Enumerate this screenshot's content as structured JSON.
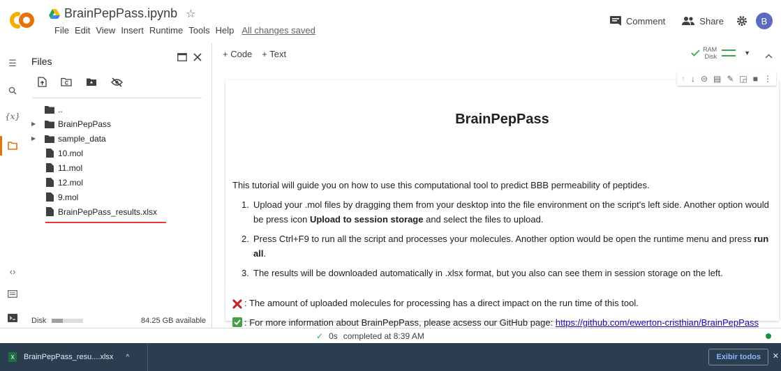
{
  "header": {
    "notebook_title": "BrainPepPass.ipynb",
    "menu": [
      "File",
      "Edit",
      "View",
      "Insert",
      "Runtime",
      "Tools",
      "Help"
    ],
    "save_status": "All changes saved",
    "comment_label": "Comment",
    "share_label": "Share",
    "avatar_letter": "B"
  },
  "files_panel": {
    "title": "Files",
    "tree": [
      {
        "label": "..",
        "type": "folder",
        "expandable": false
      },
      {
        "label": "BrainPepPass",
        "type": "folder",
        "expandable": true
      },
      {
        "label": "sample_data",
        "type": "folder",
        "expandable": true
      },
      {
        "label": "10.mol",
        "type": "file",
        "expandable": false
      },
      {
        "label": "11.mol",
        "type": "file",
        "expandable": false
      },
      {
        "label": "12.mol",
        "type": "file",
        "expandable": false
      },
      {
        "label": "9.mol",
        "type": "file",
        "expandable": false
      },
      {
        "label": "BrainPepPass_results.xlsx",
        "type": "file",
        "expandable": false
      }
    ],
    "disk_label": "Disk",
    "disk_fill_fraction": 0.35,
    "disk_available": "84.25 GB available"
  },
  "toolbar": {
    "add_code": "+ Code",
    "add_text": "+ Text",
    "ram_label": "RAM",
    "disk_label": "Disk"
  },
  "cell": {
    "heading": "BrainPepPass",
    "intro": "This tutorial will guide you on how to use this computational tool to predict BBB permeability of peptides.",
    "steps": [
      {
        "num": "1.",
        "before": "Upload your .mol files by dragging them from your desktop into the file environment on the script's left side. Another option would be press icon ",
        "bold": "Upload to session storage",
        "after": " and select the files to upload."
      },
      {
        "num": "2.",
        "before": "Press Ctrl+F9 to run all the script and processes your molecules. Another option would be open the runtime menu and press ",
        "bold": "run all",
        "after": "."
      },
      {
        "num": "3.",
        "before": "The results will be downloaded automatically in .xlsx format, but you also can see them in session storage on the left.",
        "bold": "",
        "after": ""
      }
    ],
    "warning_note": ": The amount of uploaded molecules for processing has a direct impact on the run time of this tool.",
    "info_note_before": ": For more information about BrainPepPass, please acsess our GitHub page: ",
    "info_link": "https://github.com/ewerton-cristhian/BrainPepPass"
  },
  "status_bar": {
    "check": "✓",
    "duration": "0s",
    "completed": "completed at 8:39 AM"
  },
  "download_bar": {
    "file_name": "BrainPepPass_resu....xlsx",
    "show_all": "Exibir todos"
  },
  "colors": {
    "accent": "#e8710a",
    "link": "#1a0dab",
    "ok": "#34a853",
    "download_bar": "#2b3e50"
  }
}
